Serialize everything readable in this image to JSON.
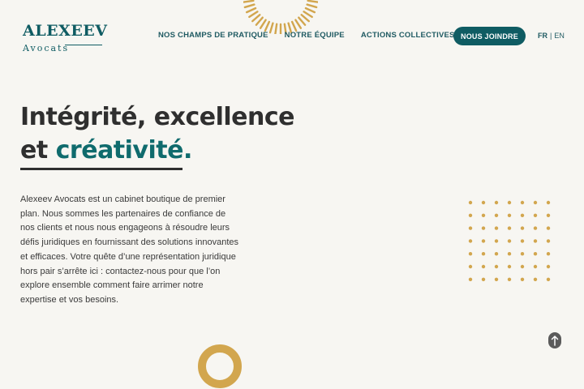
{
  "header": {
    "logo": {
      "name": "Alexeev",
      "subtitle": "Avocats"
    },
    "nav": [
      {
        "label": "NOS CHAMPS DE PRATIQUE"
      },
      {
        "label": "NOTRE ÉQUIPE"
      },
      {
        "label": "ACTIONS COLLECTIVES"
      }
    ],
    "cta_label": "NOUS JOINDRE",
    "lang": {
      "active": "FR",
      "separator": "|",
      "other": "EN"
    }
  },
  "hero": {
    "title_line1": "Intégrité, excellence",
    "title_line2_prefix": "et ",
    "title_line2_accent": "créativité.",
    "paragraph": "Alexeev Avocats est un cabinet boutique de premier plan. Nous sommes les partenaires de confiance de nos clients et nous nous engageons à résoudre leurs défis juridiques en fournissant des solutions innovantes et efficaces. Votre quête d’une représentation juridique hors pair s’arrête ici : contactez-nous pour que l’on explore ensemble comment faire arrimer notre expertise et vos besoins."
  },
  "colors": {
    "brand_teal": "#0f5c63",
    "accent_teal": "#0f6b6d",
    "gold": "#d2a64e",
    "background": "#f7f6f2",
    "text_dark": "#2f2f2f"
  },
  "icons": {
    "sunburst": "sunburst-decoration",
    "dots": "dot-grid-decoration",
    "ring": "ring-decoration",
    "scroll_top": "arrow-up-icon"
  }
}
